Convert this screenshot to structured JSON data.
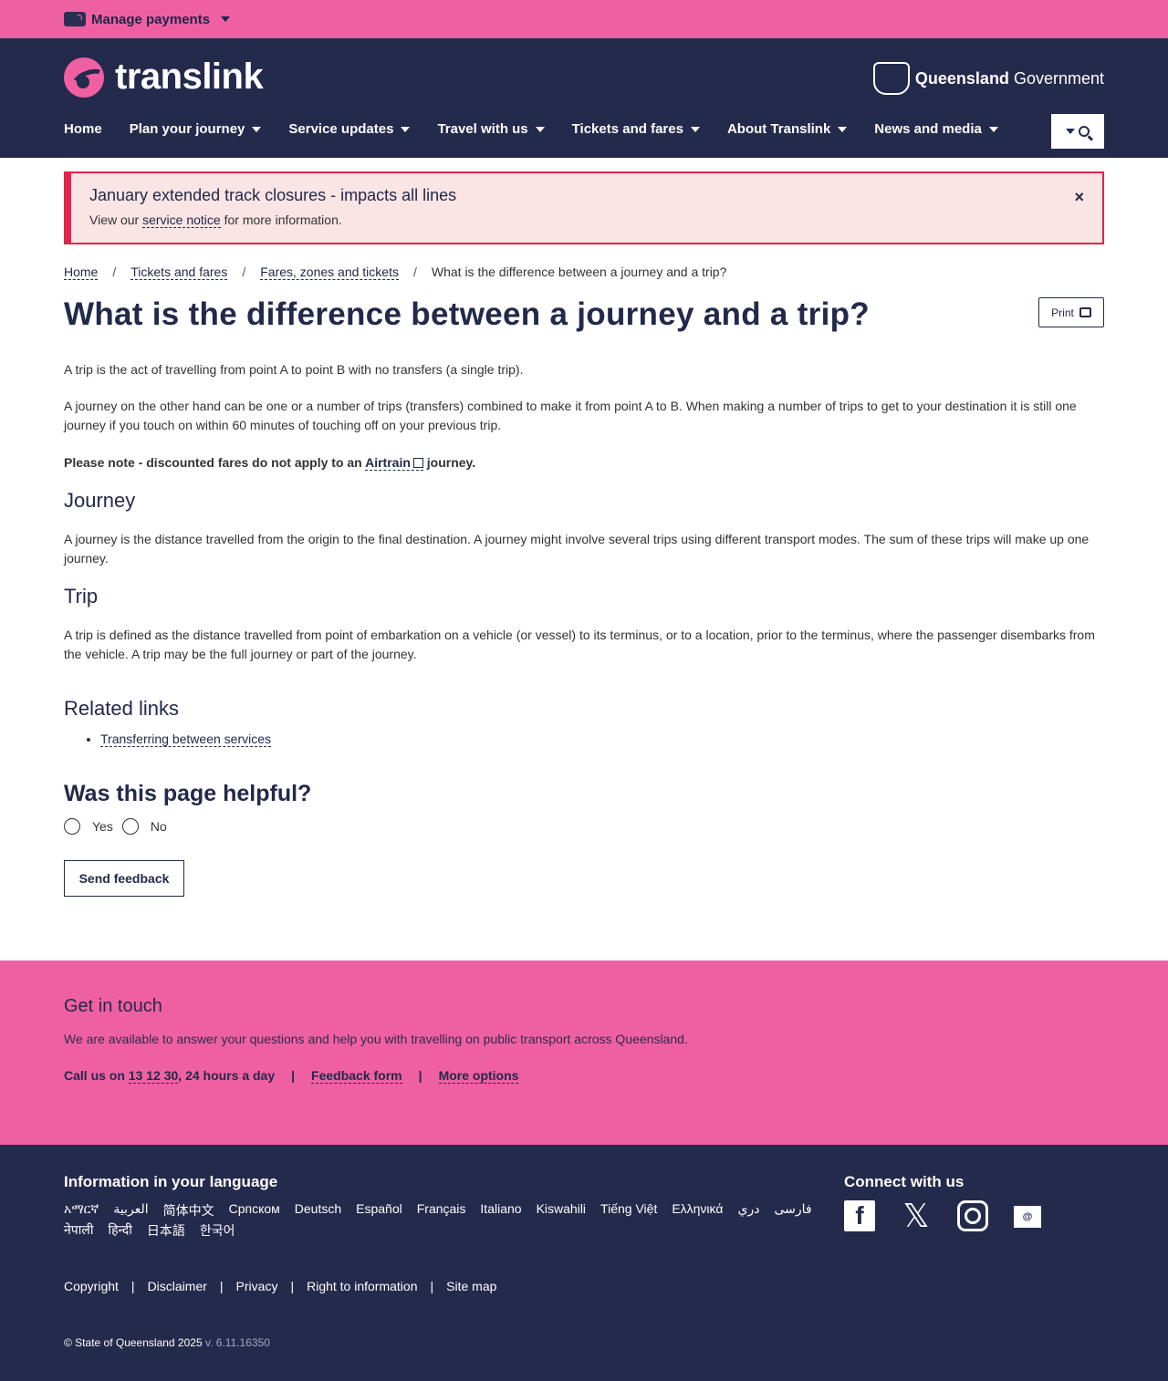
{
  "topbar": {
    "manage_payments": "Manage payments"
  },
  "header": {
    "brand": "translink",
    "gov_bold": "Queensland",
    "gov_light": "Government",
    "nav": [
      "Home",
      "Plan your journey",
      "Service updates",
      "Travel with us",
      "Tickets and fares",
      "About Translink",
      "News and media"
    ]
  },
  "alert": {
    "title": "January extended track closures - impacts all lines",
    "prefix": "View our",
    "link": "service notice",
    "suffix": "for more information.",
    "close": "×"
  },
  "breadcrumb": [
    "Home",
    "Tickets and fares",
    "Fares, zones and tickets",
    "What is the difference between a journey and a trip?"
  ],
  "page": {
    "title": "What is the difference between a journey and a trip?",
    "print_label": "Print",
    "p1": "A trip is the act of travelling from point A to point B with no transfers (a single trip).",
    "p2": "A journey on the other hand can be one or a number of trips (transfers) combined to make it from point A to B. When making a number of trips to get to your destination it is still one journey if you touch on within 60 minutes of touching off on your previous trip.",
    "note_prefix": "Please note - discounted fares do not apply to an",
    "note_link": "Airtrain",
    "note_suffix": "journey.",
    "journey_heading": "Journey",
    "journey_text": "A journey is the distance travelled from the origin to the final destination. A journey might involve several trips using different transport modes. The sum of these trips will make up one journey.",
    "trip_heading": "Trip",
    "trip_text": "A trip is defined as the distance travelled from point of embarkation on a vehicle (or vessel) to its terminus, or to a location, prior to the terminus, where the passenger disembarks from the vehicle. A trip may be the full journey or part of the journey.",
    "related_heading": "Related links",
    "related_links": [
      "Transferring between services"
    ],
    "helpful_heading": "Was this page helpful?",
    "yes": "Yes",
    "no": "No",
    "send_feedback": "Send feedback"
  },
  "touch": {
    "heading": "Get in touch",
    "desc": "We are available to answer your questions and help you with travelling on public transport across Queensland.",
    "call_prefix": "Call us on",
    "phone": "13 12 30",
    "call_suffix": ", 24 hours a day",
    "sep": "|",
    "feedback_form": "Feedback form",
    "more_options": "More options"
  },
  "footer": {
    "lang_heading": "Information in your language",
    "languages": [
      "አማርኛ",
      "العربية",
      "简体中文",
      "Српском",
      "Deutsch",
      "Español",
      "Français",
      "Italiano",
      "Kiswahili",
      "Tiếng Việt",
      "Ελληνικά",
      "دري",
      "فارسی",
      "नेपाली",
      "हिन्दी",
      "日本語",
      "한국어"
    ],
    "connect_heading": "Connect with us",
    "socials": [
      "facebook-icon",
      "x-icon",
      "instagram-icon",
      "email-icon"
    ],
    "legal_links": [
      "Copyright",
      "Disclaimer",
      "Privacy",
      "Right to information",
      "Site map"
    ],
    "copyright": "© State of Queensland 2025",
    "version": "v. 6.11.16350"
  },
  "colors": {
    "pink": "#ef60a3",
    "navy": "#232a4c",
    "alert_red": "#e0244a"
  }
}
